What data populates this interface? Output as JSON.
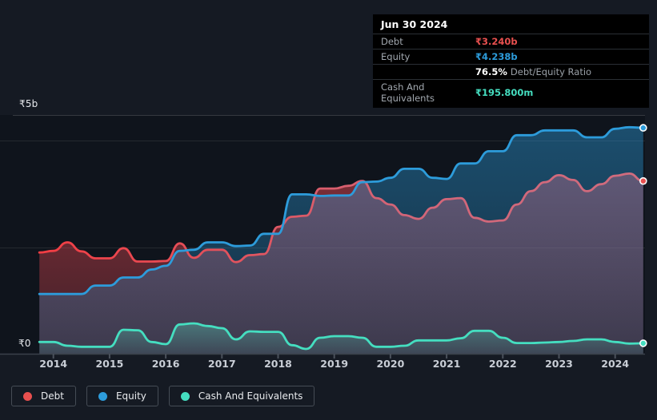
{
  "tooltip": {
    "date": "Jun 30 2024",
    "rows": [
      {
        "label": "Debt",
        "value": "₹3.240b"
      },
      {
        "label": "Equity",
        "value": "₹4.238b"
      },
      {
        "label": "Cash And Equivalents",
        "value": "₹195.800m"
      }
    ],
    "ratio": {
      "value": "76.5%",
      "label": "Debt/Equity Ratio"
    }
  },
  "colors": {
    "debt": "#E8504F",
    "debt_line_start": "#F23D43",
    "debt_line_end": "#D06C7E",
    "equity": "#2D9CDB",
    "cash": "#45DEC0",
    "background": "#151A23",
    "plot_background": "#0F141C",
    "tooltip_background": "#000000",
    "gridline": "#3A414B"
  },
  "chart_data": {
    "type": "area",
    "x_ticks": [
      "2014",
      "2015",
      "2016",
      "2017",
      "2018",
      "2019",
      "2020",
      "2021",
      "2022",
      "2023",
      "2024"
    ],
    "y_axis": {
      "top_label": "₹5b",
      "bottom_label": "₹0",
      "min": 0,
      "max": 5,
      "unit": "₹ billions"
    },
    "legend_position": "bottom-left",
    "grid": true,
    "x_years": [
      2013.75,
      2014,
      2014.25,
      2014.5,
      2014.75,
      2015,
      2015.25,
      2015.5,
      2015.75,
      2016,
      2016.25,
      2016.5,
      2016.75,
      2017,
      2017.25,
      2017.5,
      2017.75,
      2018,
      2018.25,
      2018.5,
      2018.75,
      2019,
      2019.25,
      2019.5,
      2019.75,
      2020,
      2020.25,
      2020.5,
      2020.75,
      2021,
      2021.25,
      2021.5,
      2021.75,
      2022,
      2022.25,
      2022.5,
      2022.75,
      2023,
      2023.25,
      2023.5,
      2023.75,
      2024,
      2024.25,
      2024.5
    ],
    "series": [
      {
        "key": "debt",
        "name": "Debt",
        "color": "#E8504F",
        "values": [
          1.9,
          1.93,
          2.09,
          1.92,
          1.79,
          1.79,
          1.98,
          1.73,
          1.73,
          1.74,
          2.07,
          1.8,
          1.95,
          1.95,
          1.72,
          1.85,
          1.87,
          2.38,
          2.57,
          2.59,
          3.1,
          3.1,
          3.15,
          3.24,
          2.92,
          2.8,
          2.6,
          2.53,
          2.74,
          2.9,
          2.92,
          2.55,
          2.48,
          2.5,
          2.8,
          3.05,
          3.22,
          3.35,
          3.26,
          3.05,
          3.18,
          3.34,
          3.38,
          3.24
        ]
      },
      {
        "key": "equity",
        "name": "Equity",
        "color": "#2D9CDB",
        "values": [
          1.12,
          1.12,
          1.12,
          1.12,
          1.28,
          1.28,
          1.43,
          1.43,
          1.58,
          1.65,
          1.93,
          1.95,
          2.09,
          2.09,
          2.02,
          2.03,
          2.25,
          2.25,
          2.99,
          2.99,
          2.96,
          2.97,
          2.97,
          3.22,
          3.23,
          3.3,
          3.47,
          3.47,
          3.3,
          3.28,
          3.57,
          3.57,
          3.8,
          3.8,
          4.1,
          4.1,
          4.19,
          4.19,
          4.19,
          4.06,
          4.06,
          4.22,
          4.25,
          4.238
        ]
      },
      {
        "key": "cash",
        "name": "Cash And Equivalents",
        "color": "#45DEC0",
        "values": [
          0.22,
          0.22,
          0.15,
          0.13,
          0.13,
          0.13,
          0.45,
          0.44,
          0.22,
          0.18,
          0.55,
          0.57,
          0.52,
          0.48,
          0.27,
          0.42,
          0.41,
          0.41,
          0.16,
          0.09,
          0.3,
          0.33,
          0.33,
          0.3,
          0.13,
          0.13,
          0.15,
          0.25,
          0.25,
          0.25,
          0.29,
          0.43,
          0.43,
          0.3,
          0.2,
          0.2,
          0.21,
          0.22,
          0.24,
          0.27,
          0.27,
          0.22,
          0.19,
          0.1958
        ]
      }
    ]
  }
}
